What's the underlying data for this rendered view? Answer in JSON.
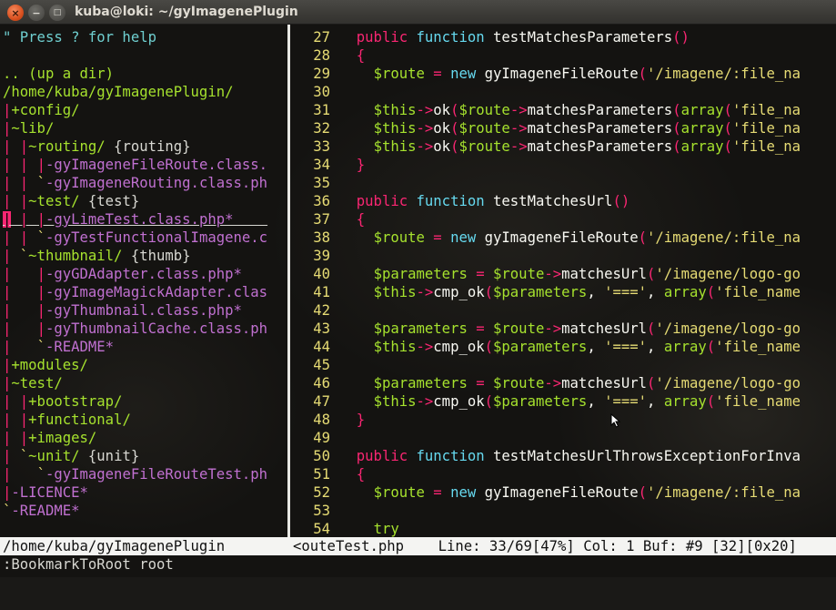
{
  "window": {
    "title": "kuba@loki: ~/gyImagenePlugin",
    "close_glyph": "×",
    "minimize_glyph": "−",
    "maximize_glyph": "□"
  },
  "nerdtree": {
    "lines": [
      [
        [
          "\" Press ? for help",
          "help"
        ]
      ],
      [
        [
          "",
          "plain"
        ]
      ],
      [
        [
          ".. (up a dir)",
          "dir"
        ]
      ],
      [
        [
          "/home/kuba/gyImagenePlugin/",
          "dir"
        ]
      ],
      [
        [
          "|",
          "pipe"
        ],
        [
          "+config/",
          "dir"
        ]
      ],
      [
        [
          "|",
          "pipe"
        ],
        [
          "~lib/",
          "dir"
        ]
      ],
      [
        [
          "| ",
          "pipe"
        ],
        [
          "|",
          "pipe"
        ],
        [
          "~routing/",
          "dir"
        ],
        [
          " {routing}",
          "tag"
        ]
      ],
      [
        [
          "| | ",
          "pipe"
        ],
        [
          "|",
          "pipe"
        ],
        [
          "-gyImageneFileRoute.class.",
          "file"
        ]
      ],
      [
        [
          "| | ",
          "pipe"
        ],
        [
          "`",
          "branch"
        ],
        [
          "-gyImageneRouting.class.ph",
          "file"
        ]
      ],
      [
        [
          "| ",
          "pipe"
        ],
        [
          "|",
          "pipe"
        ],
        [
          "~test/",
          "dir"
        ],
        [
          " {test}",
          "tag"
        ]
      ],
      [
        [
          "|",
          "cursor"
        ],
        [
          " | ",
          "pipe"
        ],
        [
          "|",
          "pipe"
        ],
        [
          "-gyLimeTest.class.php*    ",
          "file"
        ]
      ],
      [
        [
          "| | ",
          "pipe"
        ],
        [
          "`",
          "branch"
        ],
        [
          "-gyTestFunctionalImagene.c",
          "file"
        ]
      ],
      [
        [
          "| ",
          "pipe"
        ],
        [
          "`",
          "branch"
        ],
        [
          "~thumbnail/",
          "dir"
        ],
        [
          " {thumb}",
          "tag"
        ]
      ],
      [
        [
          "|   ",
          "pipe"
        ],
        [
          "|",
          "pipe"
        ],
        [
          "-gyGDAdapter.class.php*",
          "file"
        ]
      ],
      [
        [
          "|   ",
          "pipe"
        ],
        [
          "|",
          "pipe"
        ],
        [
          "-gyImageMagickAdapter.clas",
          "file"
        ]
      ],
      [
        [
          "|   ",
          "pipe"
        ],
        [
          "|",
          "pipe"
        ],
        [
          "-gyThumbnail.class.php*",
          "file"
        ]
      ],
      [
        [
          "|   ",
          "pipe"
        ],
        [
          "|",
          "pipe"
        ],
        [
          "-gyThumbnailCache.class.ph",
          "file"
        ]
      ],
      [
        [
          "|   ",
          "pipe"
        ],
        [
          "`",
          "branch"
        ],
        [
          "-README*",
          "file"
        ]
      ],
      [
        [
          "|",
          "pipe"
        ],
        [
          "+modules/",
          "dir"
        ]
      ],
      [
        [
          "|",
          "pipe"
        ],
        [
          "~test/",
          "dir"
        ]
      ],
      [
        [
          "| ",
          "pipe"
        ],
        [
          "|",
          "pipe"
        ],
        [
          "+bootstrap/",
          "dir"
        ]
      ],
      [
        [
          "| ",
          "pipe"
        ],
        [
          "|",
          "pipe"
        ],
        [
          "+functional/",
          "dir"
        ]
      ],
      [
        [
          "| ",
          "pipe"
        ],
        [
          "|",
          "pipe"
        ],
        [
          "+images/",
          "dir"
        ]
      ],
      [
        [
          "| ",
          "pipe"
        ],
        [
          "`",
          "branch"
        ],
        [
          "~unit/",
          "dir"
        ],
        [
          " {unit}",
          "tag"
        ]
      ],
      [
        [
          "|   ",
          "pipe"
        ],
        [
          "`",
          "branch"
        ],
        [
          "-gyImageneFileRouteTest.ph",
          "file"
        ]
      ],
      [
        [
          "|",
          "pipe"
        ],
        [
          "-LICENCE*",
          "file"
        ]
      ],
      [
        [
          "`",
          "branch"
        ],
        [
          "-README*",
          "file"
        ]
      ],
      [
        [
          "",
          "plain"
        ]
      ],
      [
        [
          "~",
          "tilde"
        ]
      ]
    ]
  },
  "editor": {
    "lines": [
      [
        "27",
        [
          [
            "  ",
            "fn"
          ],
          [
            "public",
            "kw2"
          ],
          [
            " ",
            "fn"
          ],
          [
            "function",
            "kw"
          ],
          [
            " testMatchesParameters",
            "fn"
          ],
          [
            "()",
            "paren"
          ]
        ]
      ],
      [
        "28",
        [
          [
            "  ",
            "fn"
          ],
          [
            "{",
            "brace"
          ]
        ]
      ],
      [
        "29",
        [
          [
            "    ",
            "fn"
          ],
          [
            "$route",
            "var"
          ],
          [
            " = ",
            "kw2"
          ],
          [
            "new",
            "kw"
          ],
          [
            " gyImageneFileRoute",
            "fn"
          ],
          [
            "(",
            "paren"
          ],
          [
            "'/imagene/:file_na",
            "str"
          ]
        ]
      ],
      [
        "30",
        []
      ],
      [
        "31",
        [
          [
            "    ",
            "fn"
          ],
          [
            "$this",
            "var"
          ],
          [
            "->",
            "kw2"
          ],
          [
            "ok",
            "fn"
          ],
          [
            "(",
            "paren"
          ],
          [
            "$route",
            "var"
          ],
          [
            "->",
            "kw2"
          ],
          [
            "matchesParameters",
            "fn"
          ],
          [
            "(",
            "paren"
          ],
          [
            "array",
            "var"
          ],
          [
            "(",
            "paren"
          ],
          [
            "'file_na",
            "str"
          ]
        ]
      ],
      [
        "32",
        [
          [
            "    ",
            "fn"
          ],
          [
            "$this",
            "var"
          ],
          [
            "->",
            "kw2"
          ],
          [
            "ok",
            "fn"
          ],
          [
            "(",
            "paren"
          ],
          [
            "$route",
            "var"
          ],
          [
            "->",
            "kw2"
          ],
          [
            "matchesParameters",
            "fn"
          ],
          [
            "(",
            "paren"
          ],
          [
            "array",
            "var"
          ],
          [
            "(",
            "paren"
          ],
          [
            "'file_na",
            "str"
          ]
        ]
      ],
      [
        "33",
        [
          [
            "    ",
            "fn"
          ],
          [
            "$this",
            "var"
          ],
          [
            "->",
            "kw2"
          ],
          [
            "ok",
            "fn"
          ],
          [
            "(",
            "paren"
          ],
          [
            "$route",
            "var"
          ],
          [
            "->",
            "kw2"
          ],
          [
            "matchesParameters",
            "fn"
          ],
          [
            "(",
            "paren"
          ],
          [
            "array",
            "var"
          ],
          [
            "(",
            "paren"
          ],
          [
            "'file_na",
            "str"
          ]
        ]
      ],
      [
        "34",
        [
          [
            "  ",
            "fn"
          ],
          [
            "}",
            "brace"
          ]
        ]
      ],
      [
        "35",
        []
      ],
      [
        "36",
        [
          [
            "  ",
            "fn"
          ],
          [
            "public",
            "kw2"
          ],
          [
            " ",
            "fn"
          ],
          [
            "function",
            "kw"
          ],
          [
            " testMatchesUrl",
            "fn"
          ],
          [
            "()",
            "paren"
          ]
        ]
      ],
      [
        "37",
        [
          [
            "  ",
            "fn"
          ],
          [
            "{",
            "brace"
          ]
        ]
      ],
      [
        "38",
        [
          [
            "    ",
            "fn"
          ],
          [
            "$route",
            "var"
          ],
          [
            " = ",
            "kw2"
          ],
          [
            "new",
            "kw"
          ],
          [
            " gyImageneFileRoute",
            "fn"
          ],
          [
            "(",
            "paren"
          ],
          [
            "'/imagene/:file_na",
            "str"
          ]
        ]
      ],
      [
        "39",
        []
      ],
      [
        "40",
        [
          [
            "    ",
            "fn"
          ],
          [
            "$parameters",
            "var"
          ],
          [
            " = ",
            "kw2"
          ],
          [
            "$route",
            "var"
          ],
          [
            "->",
            "kw2"
          ],
          [
            "matchesUrl",
            "fn"
          ],
          [
            "(",
            "paren"
          ],
          [
            "'/imagene/logo-go",
            "str"
          ]
        ]
      ],
      [
        "41",
        [
          [
            "    ",
            "fn"
          ],
          [
            "$this",
            "var"
          ],
          [
            "->",
            "kw2"
          ],
          [
            "cmp_ok",
            "fn"
          ],
          [
            "(",
            "paren"
          ],
          [
            "$parameters",
            "var"
          ],
          [
            ", ",
            "fn"
          ],
          [
            "'==='",
            "str"
          ],
          [
            ", ",
            "fn"
          ],
          [
            "array",
            "var"
          ],
          [
            "(",
            "paren"
          ],
          [
            "'file_name",
            "str"
          ]
        ]
      ],
      [
        "42",
        []
      ],
      [
        "43",
        [
          [
            "    ",
            "fn"
          ],
          [
            "$parameters",
            "var"
          ],
          [
            " = ",
            "kw2"
          ],
          [
            "$route",
            "var"
          ],
          [
            "->",
            "kw2"
          ],
          [
            "matchesUrl",
            "fn"
          ],
          [
            "(",
            "paren"
          ],
          [
            "'/imagene/logo-go",
            "str"
          ]
        ]
      ],
      [
        "44",
        [
          [
            "    ",
            "fn"
          ],
          [
            "$this",
            "var"
          ],
          [
            "->",
            "kw2"
          ],
          [
            "cmp_ok",
            "fn"
          ],
          [
            "(",
            "paren"
          ],
          [
            "$parameters",
            "var"
          ],
          [
            ", ",
            "fn"
          ],
          [
            "'==='",
            "str"
          ],
          [
            ", ",
            "fn"
          ],
          [
            "array",
            "var"
          ],
          [
            "(",
            "paren"
          ],
          [
            "'file_name",
            "str"
          ]
        ]
      ],
      [
        "45",
        []
      ],
      [
        "46",
        [
          [
            "    ",
            "fn"
          ],
          [
            "$parameters",
            "var"
          ],
          [
            " = ",
            "kw2"
          ],
          [
            "$route",
            "var"
          ],
          [
            "->",
            "kw2"
          ],
          [
            "matchesUrl",
            "fn"
          ],
          [
            "(",
            "paren"
          ],
          [
            "'/imagene/logo-go",
            "str"
          ]
        ]
      ],
      [
        "47",
        [
          [
            "    ",
            "fn"
          ],
          [
            "$this",
            "var"
          ],
          [
            "->",
            "kw2"
          ],
          [
            "cmp_ok",
            "fn"
          ],
          [
            "(",
            "paren"
          ],
          [
            "$parameters",
            "var"
          ],
          [
            ", ",
            "fn"
          ],
          [
            "'==='",
            "str"
          ],
          [
            ", ",
            "fn"
          ],
          [
            "array",
            "var"
          ],
          [
            "(",
            "paren"
          ],
          [
            "'file_name",
            "str"
          ]
        ]
      ],
      [
        "48",
        [
          [
            "  ",
            "fn"
          ],
          [
            "}",
            "brace"
          ]
        ]
      ],
      [
        "49",
        []
      ],
      [
        "50",
        [
          [
            "  ",
            "fn"
          ],
          [
            "public",
            "kw2"
          ],
          [
            " ",
            "fn"
          ],
          [
            "function",
            "kw"
          ],
          [
            " testMatchesUrlThrowsExceptionForInva",
            "fn"
          ]
        ]
      ],
      [
        "51",
        [
          [
            "  ",
            "fn"
          ],
          [
            "{",
            "brace"
          ]
        ]
      ],
      [
        "52",
        [
          [
            "    ",
            "fn"
          ],
          [
            "$route",
            "var"
          ],
          [
            " = ",
            "kw2"
          ],
          [
            "new",
            "kw"
          ],
          [
            " gyImageneFileRoute",
            "fn"
          ],
          [
            "(",
            "paren"
          ],
          [
            "'/imagene/:file_na",
            "str"
          ]
        ]
      ],
      [
        "53",
        []
      ],
      [
        "54",
        [
          [
            "    ",
            "fn"
          ],
          [
            "try",
            "var"
          ]
        ]
      ]
    ]
  },
  "statusline": {
    "left": "/home/kuba/gyImagenePlugin",
    "right": "<outeTest.php    Line: 33/69[47%] Col: 1 Buf: #9 [32][0x20]"
  },
  "cmdline": ":BookmarkToRoot root",
  "colors": {
    "background": "#141311",
    "directory": "#a6e22e",
    "file": "#c070d0",
    "pipe": "#f92672",
    "line_number": "#e6db74",
    "status_bg": "#f4f4f2"
  }
}
